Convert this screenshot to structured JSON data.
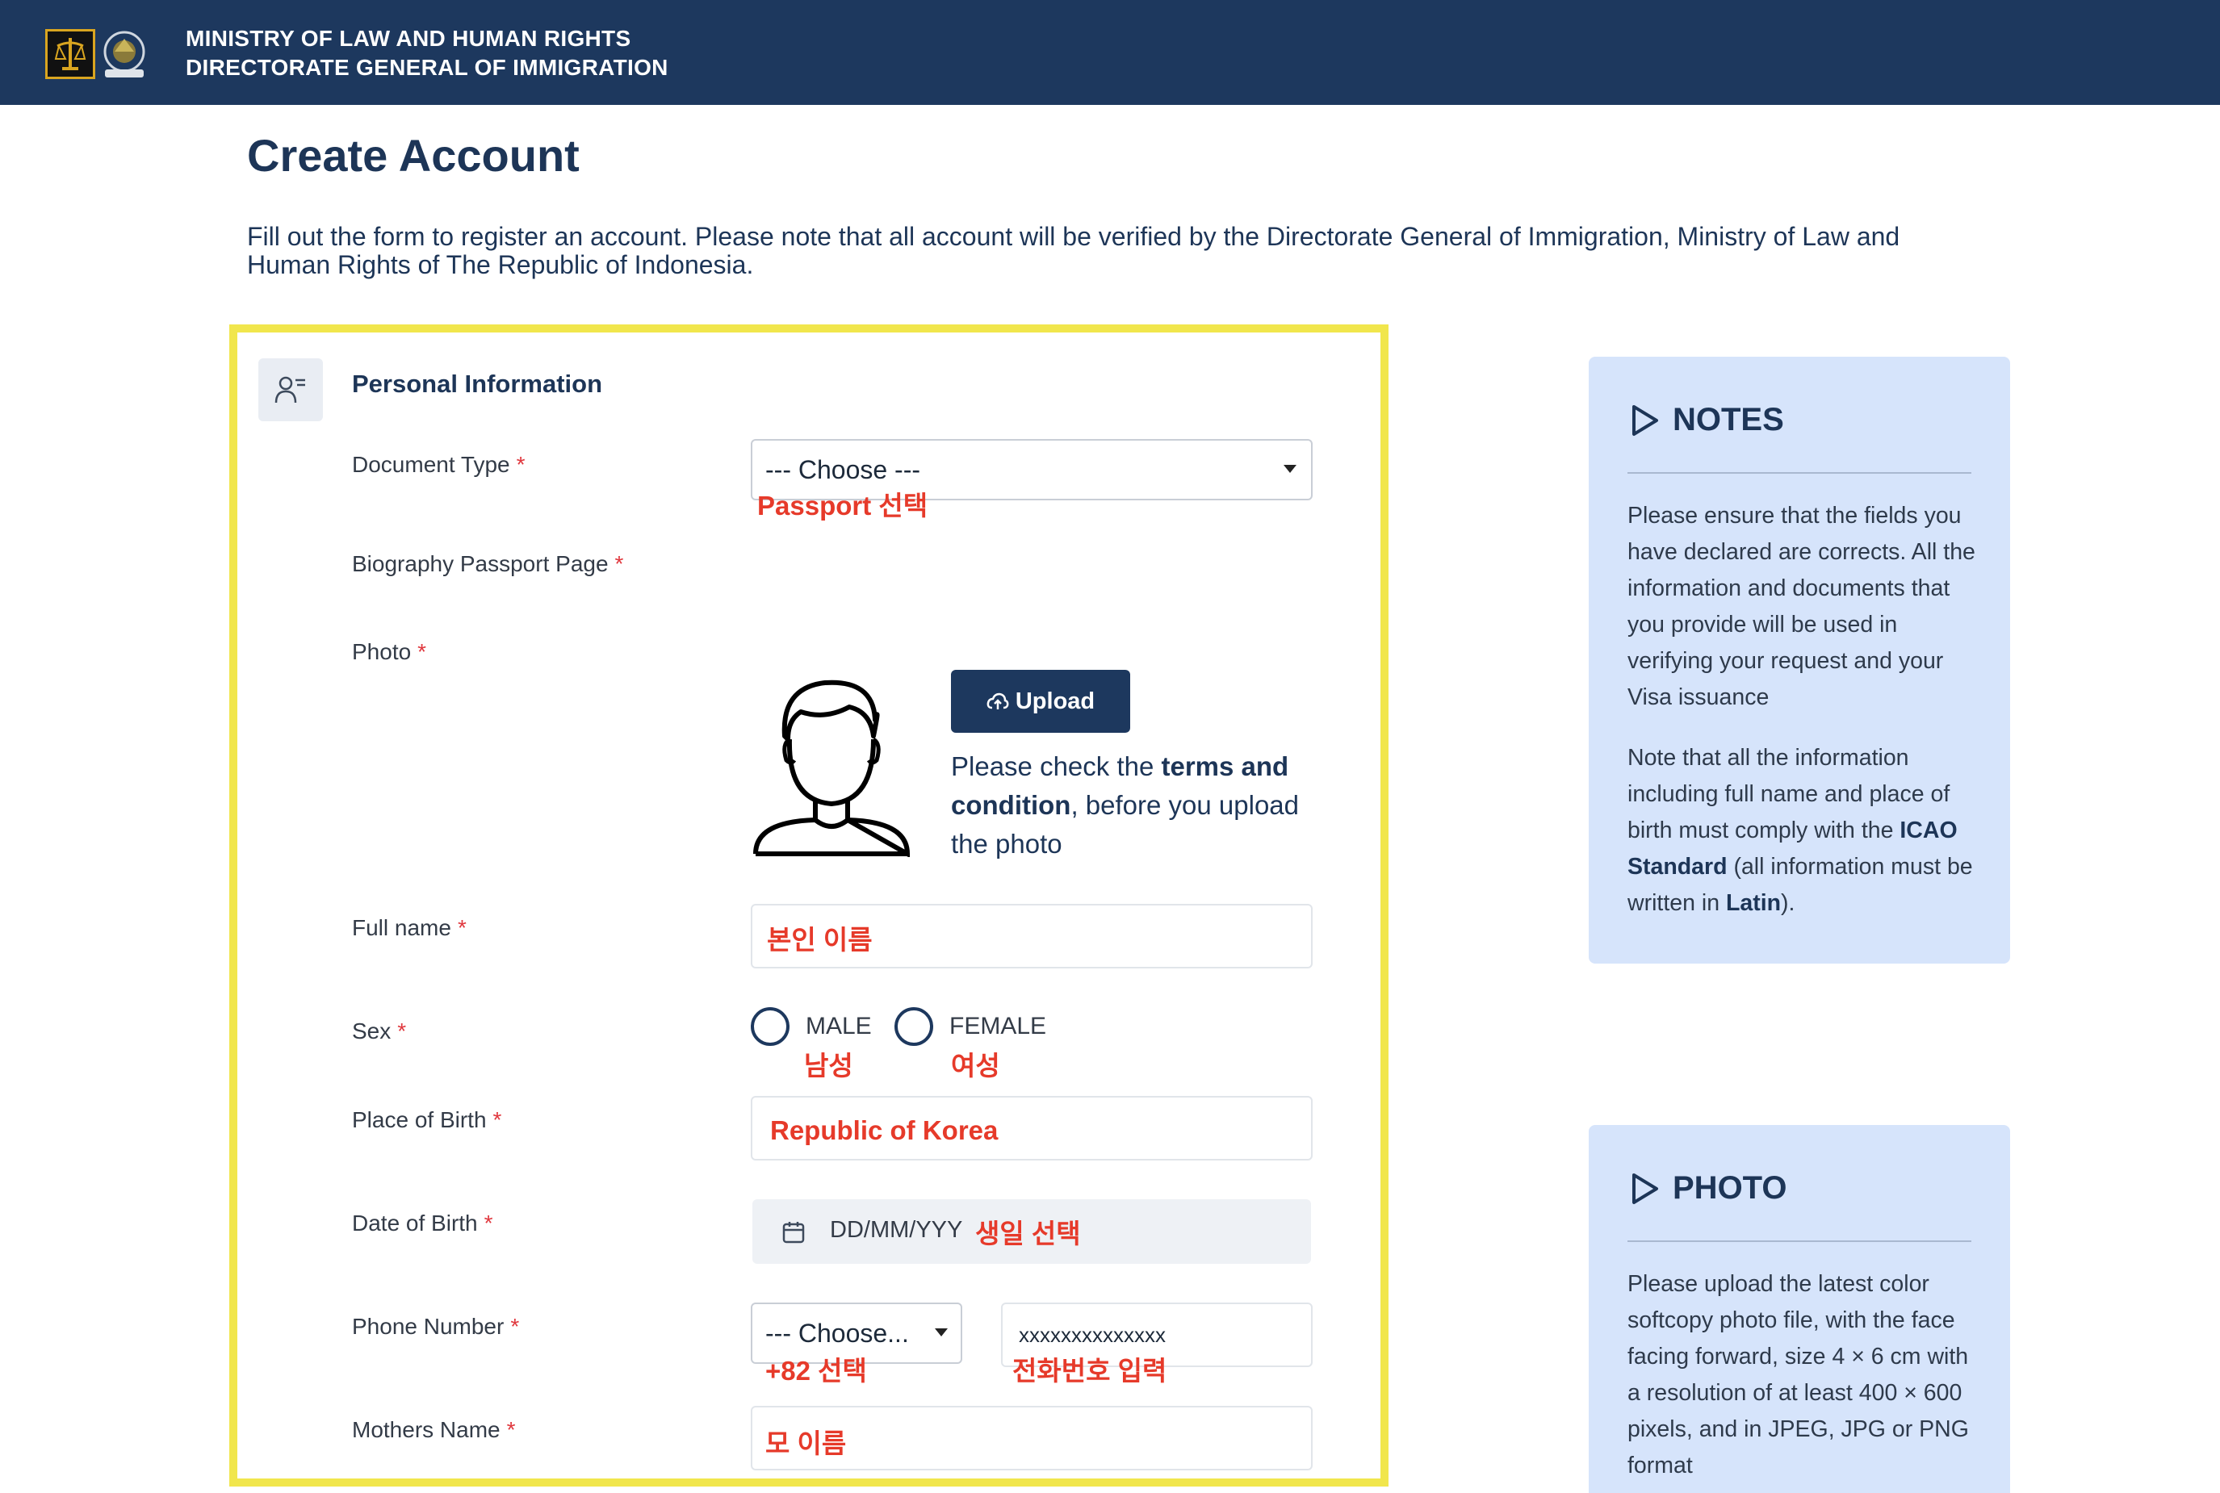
{
  "header": {
    "org_line1": "MINISTRY OF  LAW  AND HUMAN RIGHTS",
    "org_line2": "DIRECTORATE GENERAL OF IMMIGRATION"
  },
  "page": {
    "title": "Create Account",
    "intro": "Fill out the form to register an account. Please note that all account will be verified by the Directorate General of Immigration, Ministry of Law and Human Rights of The Republic of Indonesia."
  },
  "form": {
    "section_title": "Personal Information",
    "required_mark": "*",
    "document_type": {
      "label": "Document Type",
      "value": "--- Choose ---",
      "note": "Passport 선택"
    },
    "biography_page": {
      "label": "Biography Passport Page"
    },
    "photo": {
      "label": "Photo",
      "upload_label": "Upload",
      "text_pre": "Please check the ",
      "text_bold": "terms and condition",
      "text_post": ", before you upload the photo"
    },
    "full_name": {
      "label": "Full name",
      "note": "본인 이름"
    },
    "sex": {
      "label": "Sex",
      "male": "MALE",
      "female": "FEMALE",
      "male_note": "남성",
      "female_note": "여성"
    },
    "place_of_birth": {
      "label": "Place of Birth",
      "note": "Republic of Korea"
    },
    "date_of_birth": {
      "label": "Date of Birth",
      "placeholder": "DD/MM/YYY",
      "note": "생일 선택"
    },
    "phone": {
      "label": "Phone Number",
      "code_value": "--- Choose...",
      "number_value": "xxxxxxxxxxxxxx",
      "code_note": "+82 선택",
      "number_note": "전화번호 입력"
    },
    "mothers_name": {
      "label": "Mothers Name",
      "note": "모 이름"
    }
  },
  "notes": {
    "title": "NOTES",
    "p1": "Please ensure that the fields you have declared are corrects. All the information and documents that you provide will be used in verifying your request and your Visa issuance",
    "p2_pre": "Note that all the information including full name and place of birth must comply with the ",
    "p2_bold1": "ICAO Standard",
    "p2_mid": " (all information must be written in ",
    "p2_bold2": "Latin",
    "p2_post": ")."
  },
  "photo_notes": {
    "title": "PHOTO",
    "body": "Please upload the latest color softcopy photo file, with the face facing forward, size 4 × 6 cm with a resolution of at least 400 × 600 pixels, and in JPEG, JPG or PNG format"
  },
  "colors": {
    "header_bg": "#1d385e",
    "highlight_border": "#f1e64c",
    "annotation_red": "#e63a2a",
    "note_bg": "#d6e4fb"
  }
}
